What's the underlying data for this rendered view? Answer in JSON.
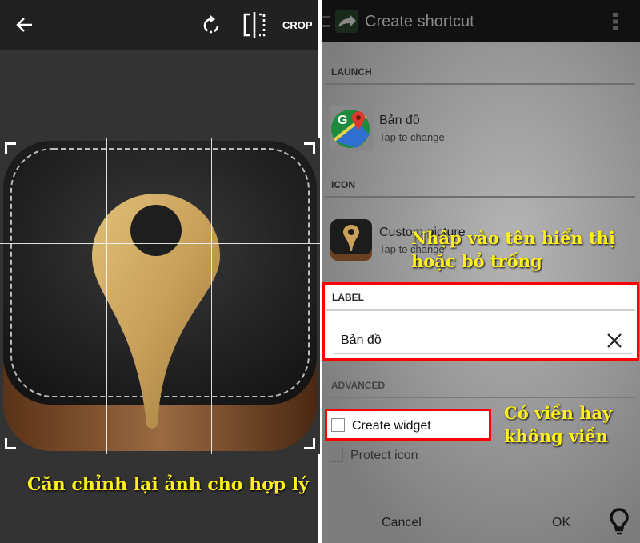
{
  "editor": {
    "crop_label": "CROP",
    "icons": [
      "back-arrow-icon",
      "rotate-icon",
      "flip-icon"
    ],
    "caption": "Căn chỉnh lại ảnh cho hợp lý"
  },
  "shortcut": {
    "title": "Create shortcut",
    "launch": {
      "header": "LAUNCH",
      "title": "Bản đồ",
      "subtitle": "Tap to change"
    },
    "icon": {
      "header": "ICON",
      "title": "Custom picture",
      "subtitle": "Tap to change"
    },
    "label": {
      "header": "LABEL",
      "value": "Bản đồ"
    },
    "advanced": {
      "header": "ADVANCED",
      "create_widget": "Create widget",
      "protect_icon": "Protect icon",
      "create_widget_checked": false,
      "protect_icon_checked": false
    },
    "cancel": "Cancel",
    "ok": "OK",
    "annotation_label": "Nhập vào tên hiển thị hoặc bỏ trống",
    "annotation_widget": "Có viền hay không viền"
  },
  "colors": {
    "highlight": "#ff0000",
    "annotation": "#ffef1a"
  }
}
